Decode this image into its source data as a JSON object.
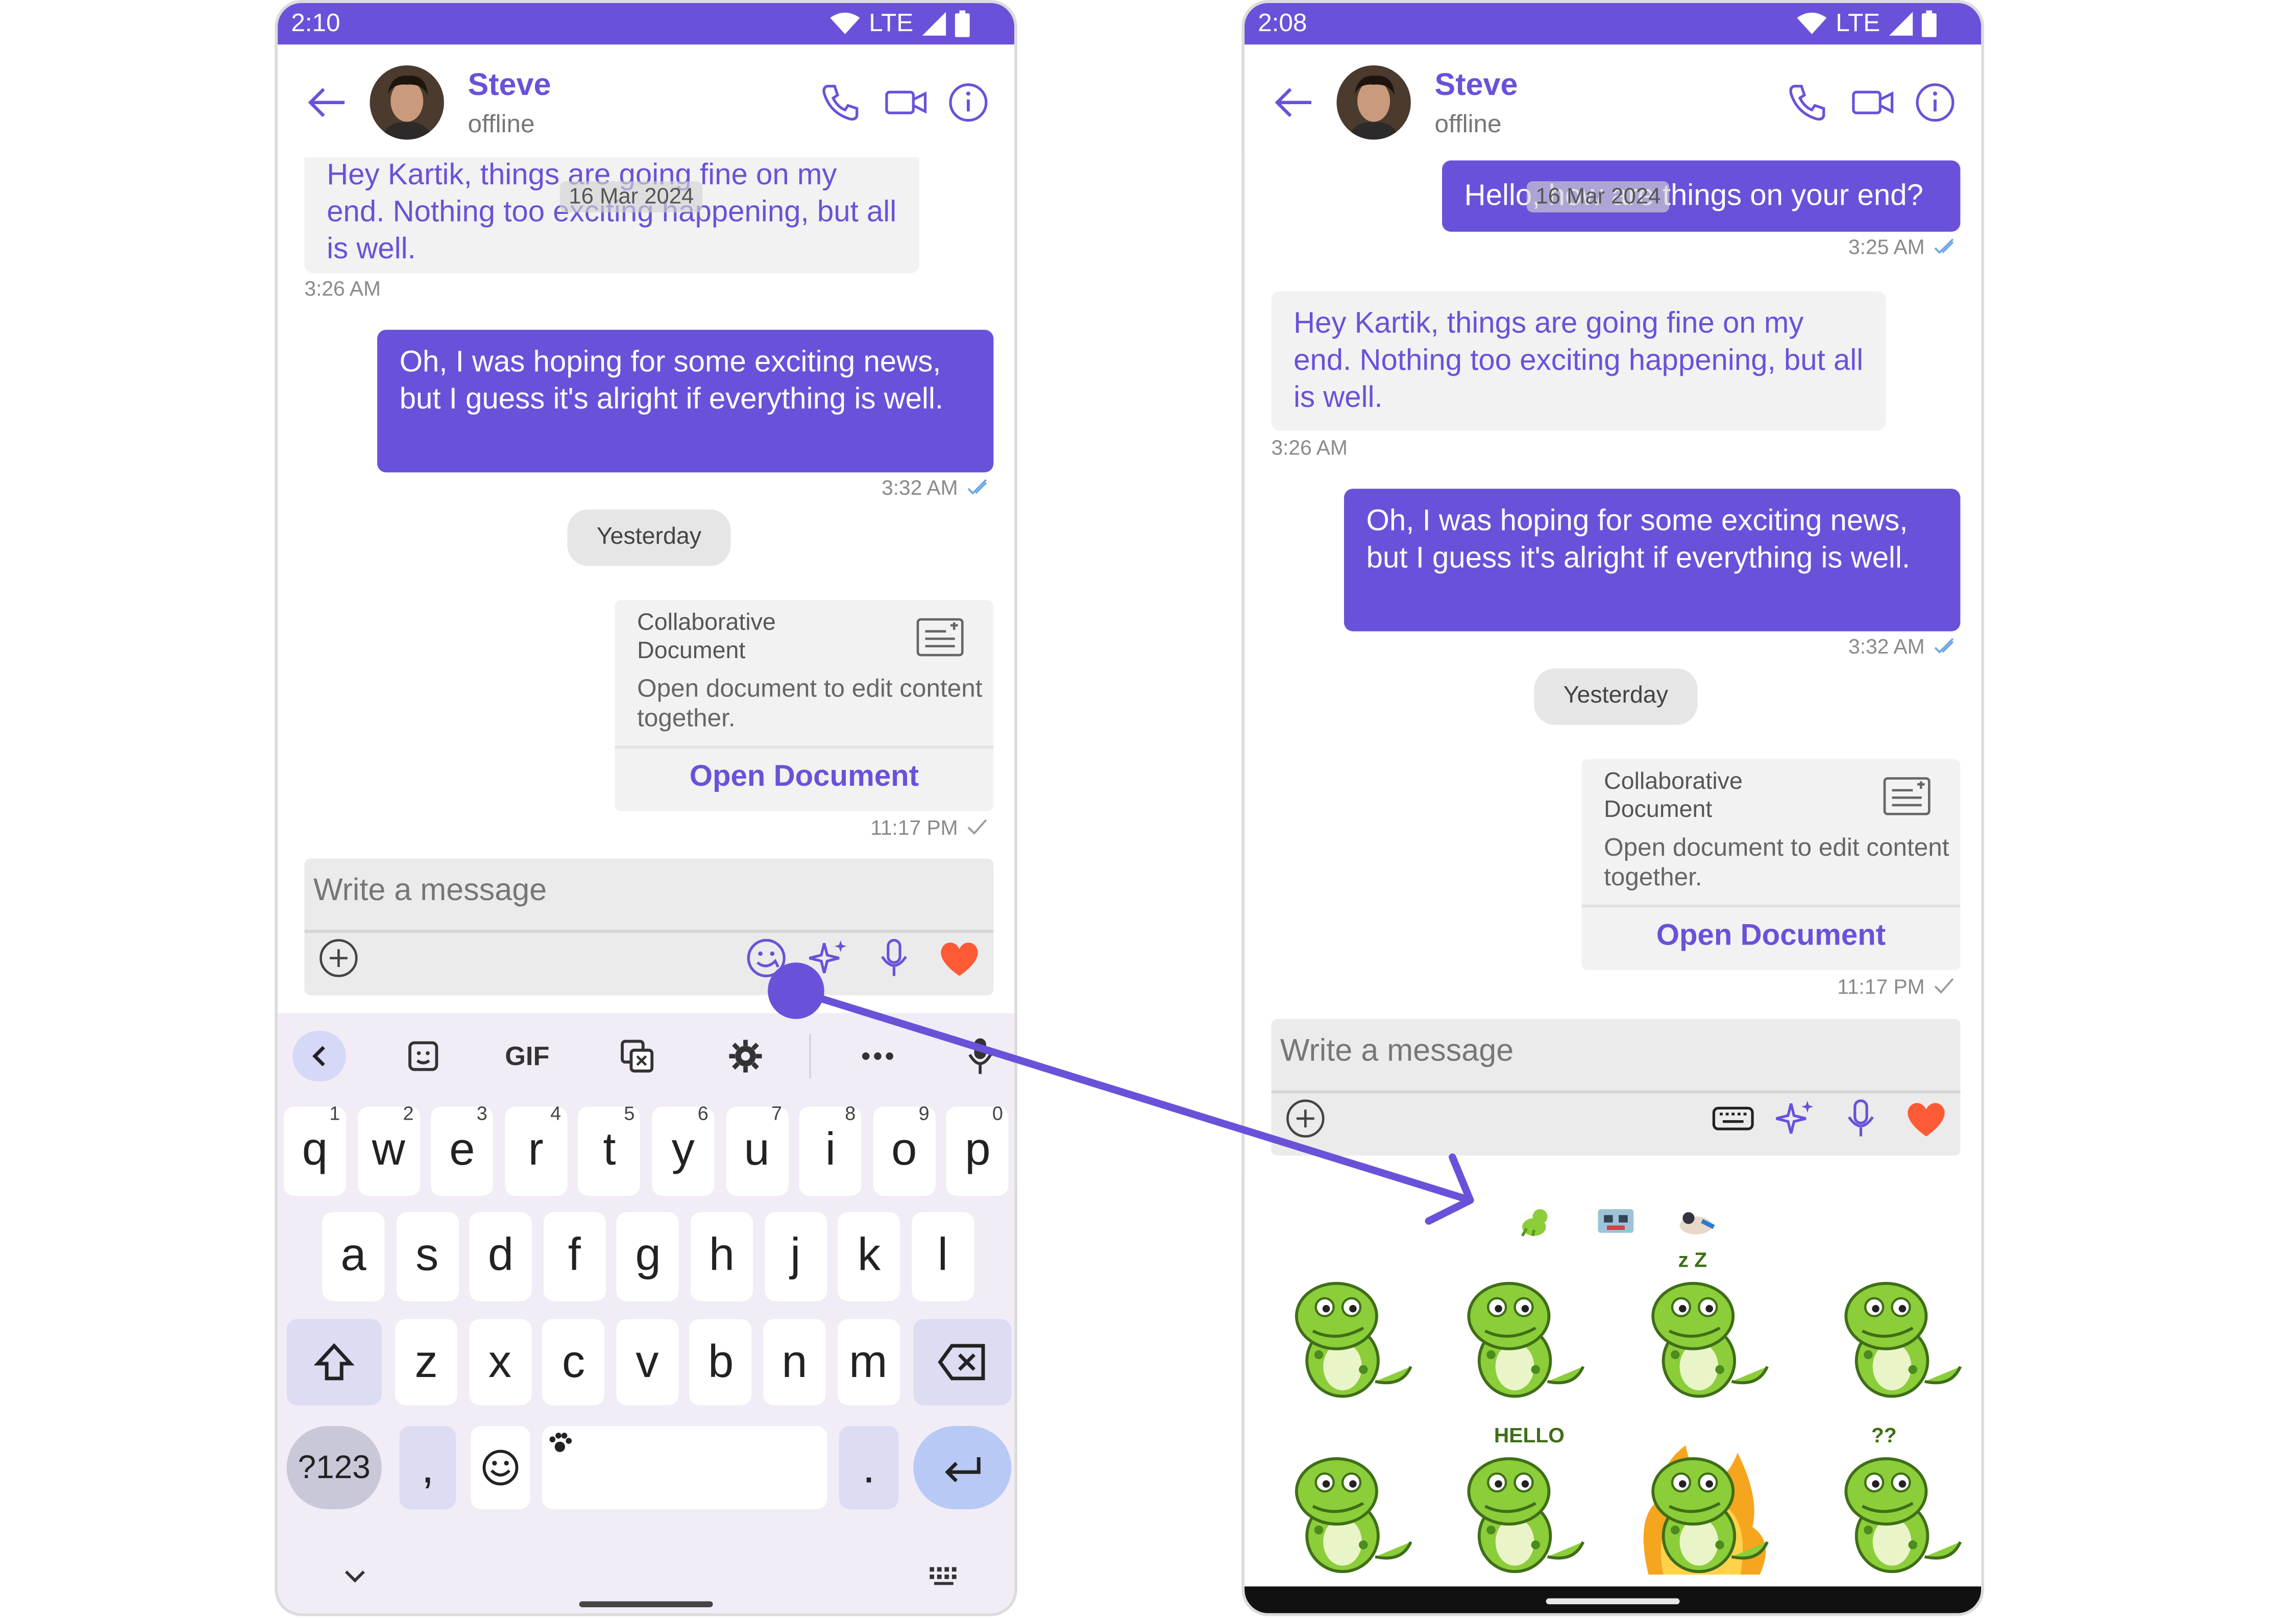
{
  "colors": {
    "accent": "#6b51d9",
    "heart": "#ff5a36",
    "sticker_green": "#8ccd3a"
  },
  "left": {
    "status": {
      "time": "2:10",
      "network": "LTE"
    },
    "header": {
      "name": "Steve",
      "status": "offline"
    },
    "date_pill": "16 Mar 2024",
    "messages": [
      {
        "text": "Hey Kartik, things are going fine on my end. Nothing too exciting happening, but all is well.",
        "time": "3:26 AM"
      },
      {
        "text": "Oh, I was hoping for some exciting news, but I guess it's alright if everything is well.",
        "time": "3:32 AM"
      }
    ],
    "separator": "Yesterday",
    "doc": {
      "title": "Collaborative Document",
      "desc": "Open document to edit content together.",
      "button": "Open Document",
      "time": "11:17 PM"
    },
    "composer": {
      "placeholder": "Write a message"
    },
    "keyboard": {
      "toolbar": {
        "gif": "GIF"
      },
      "row1": [
        "q",
        "w",
        "e",
        "r",
        "t",
        "y",
        "u",
        "i",
        "o",
        "p"
      ],
      "row1_hints": [
        "1",
        "2",
        "3",
        "4",
        "5",
        "6",
        "7",
        "8",
        "9",
        "0"
      ],
      "row2": [
        "a",
        "s",
        "d",
        "f",
        "g",
        "h",
        "j",
        "k",
        "l"
      ],
      "row3": [
        "z",
        "x",
        "c",
        "v",
        "b",
        "n",
        "m"
      ],
      "symbols": "?123",
      "comma": ",",
      "period": "."
    }
  },
  "right": {
    "status": {
      "time": "2:08",
      "network": "LTE"
    },
    "header": {
      "name": "Steve",
      "status": "offline"
    },
    "date_pill": "16 Mar 2024",
    "messages": [
      {
        "text": "Hello, how are things on your end?",
        "time": "3:25 AM"
      },
      {
        "text": "Hey Kartik, things are going fine on my end. Nothing too exciting happening, but all is well.",
        "time": "3:26 AM"
      },
      {
        "text": "Oh, I was hoping for some exciting news, but I guess it's alright if everything is well.",
        "time": "3:32 AM"
      }
    ],
    "separator": "Yesterday",
    "doc": {
      "title": "Collaborative Document",
      "desc": "Open document to edit content together.",
      "button": "Open Document",
      "time": "11:17 PM"
    },
    "composer": {
      "placeholder": "Write a message"
    },
    "sticker_tabs": [
      "dino-sticker-pack",
      "robot-sticker-pack",
      "cartoon-sticker-pack"
    ],
    "stickers": [
      {
        "name": "dino-sticker-angry",
        "caption": ""
      },
      {
        "name": "dino-sticker-sneaking",
        "caption": ""
      },
      {
        "name": "dino-sticker-sleeping",
        "caption": "z Z"
      },
      {
        "name": "dino-sticker-confused",
        "caption": ""
      },
      {
        "name": "dino-sticker-tongue",
        "caption": ""
      },
      {
        "name": "dino-sticker-hello",
        "caption": "HELLO"
      },
      {
        "name": "dino-sticker-fire",
        "caption": ""
      },
      {
        "name": "dino-sticker-question",
        "caption": "??"
      }
    ]
  }
}
